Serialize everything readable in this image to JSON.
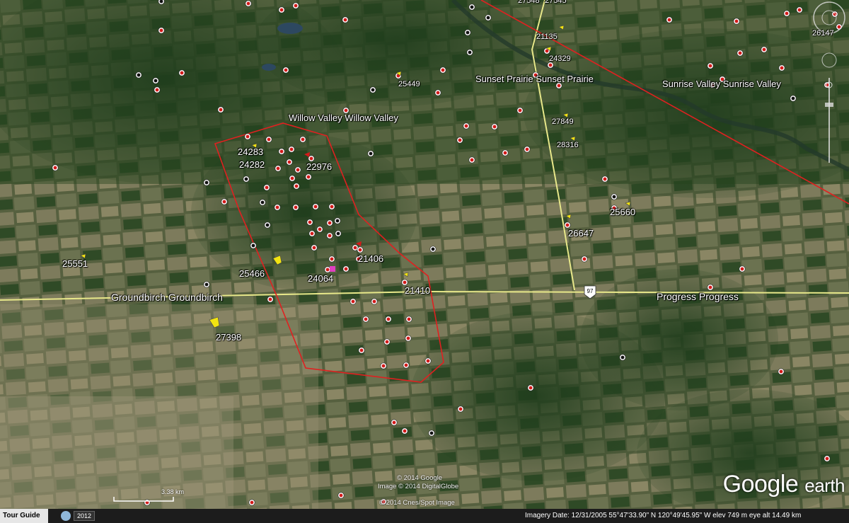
{
  "places": [
    {
      "name": "Willow Valley Willow Valley"
    },
    {
      "name": "Sunset Prairie Sunset Prairie"
    },
    {
      "name": "Sunrise Valley Sunrise Valley"
    },
    {
      "name": "Groundbirch Groundbirch"
    },
    {
      "name": "Progress Progress"
    }
  ],
  "wells": [
    "24283",
    "24282",
    "22976",
    "21406",
    "24064",
    "25466",
    "21410",
    "25551",
    "27398",
    "25660",
    "26647",
    "27849",
    "28316",
    "25449",
    "24329",
    "21135",
    "27548",
    "27545",
    "26147"
  ],
  "highway_shield": "97",
  "credits": [
    "© 2014 Google",
    "Image © 2014 DigitalGlobe",
    "© 2014 Cnes/Spot Image"
  ],
  "logo": {
    "brand": "Google",
    "product": "earth"
  },
  "scale": {
    "label": "3.38 km"
  },
  "statusbar": {
    "tour_guide": "Tour Guide",
    "year": "2012",
    "status": "Imagery Date: 12/31/2005     55°47'33.90\" N  120°49'45.95\" W  elev   749 m      eye alt  14.49 km"
  },
  "colors": {
    "boundary": "#e02020",
    "road": "#e8e88a",
    "pin_yellow": "#f2e411",
    "pin_red": "#d21a1a",
    "pin_pink": "#e040c0"
  }
}
